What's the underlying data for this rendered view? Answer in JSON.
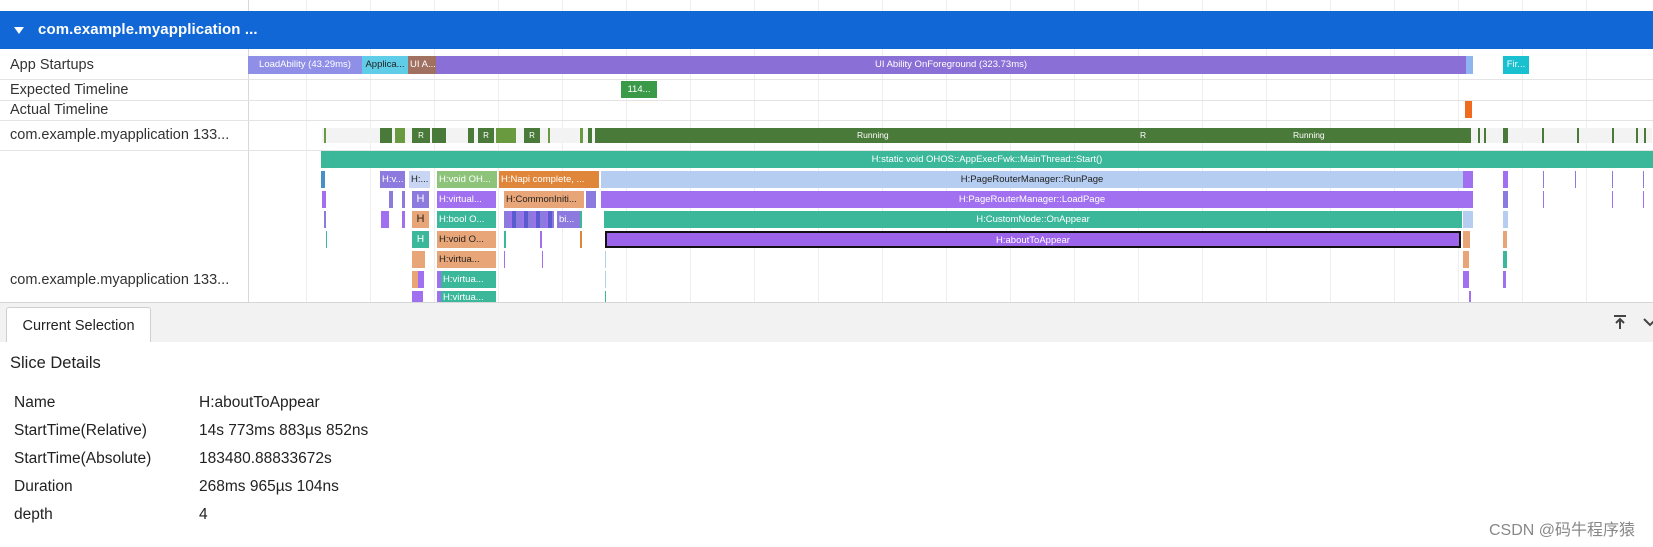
{
  "header": {
    "title": "com.example.myapplication ..."
  },
  "rows": {
    "app_startups": "App Startups",
    "expected_timeline": "Expected Timeline",
    "actual_timeline": "Actual Timeline",
    "thread": "com.example.myapplication 133...",
    "process": "com.example.myapplication 133..."
  },
  "startup_slices": [
    {
      "label": "LoadAbility (43.29ms)"
    },
    {
      "label": "Applica..."
    },
    {
      "label": "UI A..."
    },
    {
      "label": "UI Ability OnForeground (323.73ms)"
    },
    {
      "label": "Fir..."
    }
  ],
  "expected_slice": "114...",
  "thread_states": [
    "R",
    "R",
    "R",
    "Running",
    "R",
    "Running"
  ],
  "trace_slices": {
    "main": "H:static void OHOS::AppExecFwk::MainThread::Start()",
    "run_page": "H:PageRouterManager::RunPage",
    "load_page": "H:PageRouterManager::LoadPage",
    "on_appear": "H:CustomNode::OnAppear",
    "about_to_appear": "H:aboutToAppear",
    "d1_a": "H:v...",
    "d1_b": "H:...",
    "d1_c": "H:void OH...",
    "d1_d": "H:Napi complete, ...",
    "d2_a": "H",
    "d2_b": "H:virtual...",
    "d2_c": "H:CommonIniti...",
    "d3_a": "H",
    "d3_b": "H:bool O...",
    "d3_c": "bi...",
    "d4_a": "H",
    "d4_b": "H:void O...",
    "d5_a": "H:virtua...",
    "d6_a": "H:virtua...",
    "d7_a": "H:virtua..."
  },
  "panel": {
    "tab": "Current Selection",
    "section_title": "Slice Details",
    "details": [
      {
        "label": "Name",
        "value": "H:aboutToAppear"
      },
      {
        "label": "StartTime(Relative)",
        "value": "14s 773ms 883µs 852ns"
      },
      {
        "label": "StartTime(Absolute)",
        "value": "183480.88833672s"
      },
      {
        "label": "Duration",
        "value": "268ms 965µs 104ns"
      },
      {
        "label": "depth",
        "value": "4"
      }
    ]
  },
  "icons": {
    "pin": "pin-top-icon",
    "collapse": "chevron-down-icon"
  },
  "watermark": "CSDN @码牛程序猿",
  "colors": {
    "header": "#1267d6",
    "running": "#4a7a3a",
    "main_slice": "#3bb79a",
    "run_page": "#b5cdf0",
    "load_page": "#a070f0",
    "about_to_appear": "#9c64ea",
    "startup_foreground": "#8a6fd6"
  }
}
